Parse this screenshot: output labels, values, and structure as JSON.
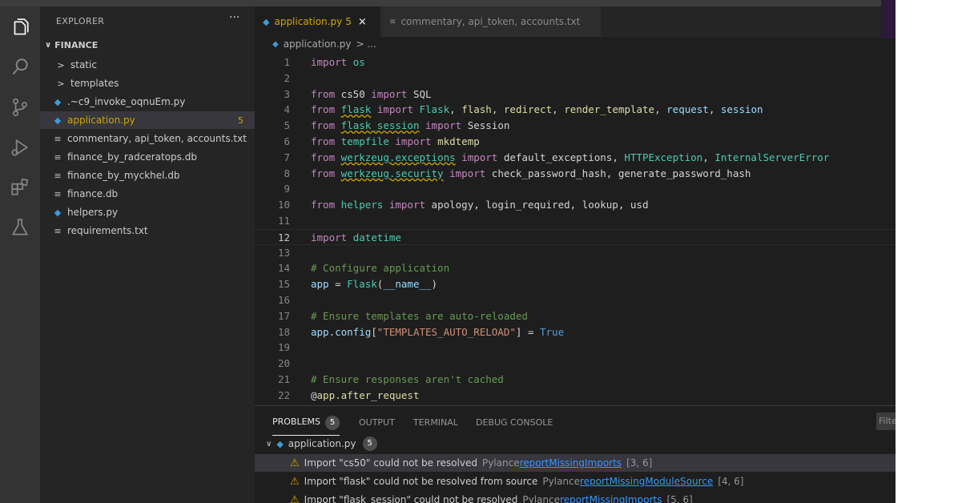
{
  "sidebar": {
    "title": "EXPLORER",
    "more": "···",
    "root": "FINANCE",
    "items": [
      {
        "label": "static",
        "kind": "folder"
      },
      {
        "label": "templates",
        "kind": "folder"
      },
      {
        "label": ".~c9_invoke_oqnuEm.py",
        "kind": "py"
      },
      {
        "label": "application.py",
        "kind": "py",
        "badge": "5"
      },
      {
        "label": "commentary, api_token, accounts.txt",
        "kind": "txt"
      },
      {
        "label": "finance_by_radceratops.db",
        "kind": "db"
      },
      {
        "label": "finance_by_myckhel.db",
        "kind": "db"
      },
      {
        "label": "finance.db",
        "kind": "db"
      },
      {
        "label": "helpers.py",
        "kind": "py"
      },
      {
        "label": "requirements.txt",
        "kind": "txt"
      }
    ]
  },
  "tabs": [
    {
      "label": "application.py",
      "count": "5",
      "close": "×"
    },
    {
      "label": "commentary, api_token, accounts.txt"
    }
  ],
  "breadcrumb": {
    "file": "application.py",
    "sep": "> ..."
  },
  "editor": {
    "current_line": 12,
    "lines": [
      {
        "n": "1",
        "tokens": [
          [
            "kw",
            "import"
          ],
          [
            "plain",
            " "
          ],
          [
            "mod",
            "os"
          ]
        ]
      },
      {
        "n": "2",
        "tokens": []
      },
      {
        "n": "3",
        "tokens": [
          [
            "kw",
            "from"
          ],
          [
            "plain",
            " cs50 "
          ],
          [
            "kw",
            "import"
          ],
          [
            "plain",
            " SQL"
          ]
        ]
      },
      {
        "n": "4",
        "tokens": [
          [
            "kw",
            "from"
          ],
          [
            "plain",
            " "
          ],
          [
            "mod sq",
            "flask"
          ],
          [
            "plain",
            " "
          ],
          [
            "kw",
            "import"
          ],
          [
            "plain",
            " "
          ],
          [
            "mod",
            "Flask"
          ],
          [
            "plain",
            ", "
          ],
          [
            "fn",
            "flash"
          ],
          [
            "plain",
            ", "
          ],
          [
            "fn",
            "redirect"
          ],
          [
            "plain",
            ", "
          ],
          [
            "fn",
            "render_template"
          ],
          [
            "plain",
            ", "
          ],
          [
            "var",
            "request"
          ],
          [
            "plain",
            ", "
          ],
          [
            "var",
            "session"
          ]
        ]
      },
      {
        "n": "5",
        "tokens": [
          [
            "kw",
            "from"
          ],
          [
            "plain",
            " "
          ],
          [
            "mod sq",
            "flask_session"
          ],
          [
            "plain",
            " "
          ],
          [
            "kw",
            "import"
          ],
          [
            "plain",
            " Session"
          ]
        ]
      },
      {
        "n": "6",
        "tokens": [
          [
            "kw",
            "from"
          ],
          [
            "plain",
            " "
          ],
          [
            "mod",
            "tempfile"
          ],
          [
            "plain",
            " "
          ],
          [
            "kw",
            "import"
          ],
          [
            "plain",
            " "
          ],
          [
            "fn",
            "mkdtemp"
          ]
        ]
      },
      {
        "n": "7",
        "tokens": [
          [
            "kw",
            "from"
          ],
          [
            "plain",
            " "
          ],
          [
            "mod sq",
            "werkzeug.exceptions"
          ],
          [
            "plain",
            " "
          ],
          [
            "kw",
            "import"
          ],
          [
            "plain",
            " default_exceptions, "
          ],
          [
            "mod",
            "HTTPException"
          ],
          [
            "plain",
            ", "
          ],
          [
            "mod",
            "InternalServerError"
          ]
        ]
      },
      {
        "n": "8",
        "tokens": [
          [
            "kw",
            "from"
          ],
          [
            "plain",
            " "
          ],
          [
            "mod sq",
            "werkzeug.security"
          ],
          [
            "plain",
            " "
          ],
          [
            "kw",
            "import"
          ],
          [
            "plain",
            " check_password_hash, generate_password_hash"
          ]
        ]
      },
      {
        "n": "9",
        "tokens": []
      },
      {
        "n": "10",
        "tokens": [
          [
            "kw",
            "from"
          ],
          [
            "plain",
            " "
          ],
          [
            "mod",
            "helpers"
          ],
          [
            "plain",
            " "
          ],
          [
            "kw",
            "import"
          ],
          [
            "plain",
            " apology, login_required, lookup, usd"
          ]
        ]
      },
      {
        "n": "11",
        "tokens": []
      },
      {
        "n": "12",
        "tokens": [
          [
            "kw",
            "import"
          ],
          [
            "plain",
            " "
          ],
          [
            "mod",
            "datetime"
          ]
        ]
      },
      {
        "n": "13",
        "tokens": []
      },
      {
        "n": "14",
        "tokens": [
          [
            "cm",
            "# Configure application"
          ]
        ]
      },
      {
        "n": "15",
        "tokens": [
          [
            "var",
            "app"
          ],
          [
            "plain",
            " = "
          ],
          [
            "mod",
            "Flask"
          ],
          [
            "plain",
            "("
          ],
          [
            "var",
            "__name__"
          ],
          [
            "plain",
            ")"
          ]
        ]
      },
      {
        "n": "16",
        "tokens": []
      },
      {
        "n": "17",
        "tokens": [
          [
            "cm",
            "# Ensure templates are auto-reloaded"
          ]
        ]
      },
      {
        "n": "18",
        "tokens": [
          [
            "var",
            "app"
          ],
          [
            "plain",
            "."
          ],
          [
            "var",
            "config"
          ],
          [
            "plain",
            "["
          ],
          [
            "str",
            "\"TEMPLATES_AUTO_RELOAD\""
          ],
          [
            "plain",
            "] = "
          ],
          [
            "const",
            "True"
          ]
        ]
      },
      {
        "n": "19",
        "tokens": []
      },
      {
        "n": "20",
        "tokens": []
      },
      {
        "n": "21",
        "tokens": [
          [
            "cm",
            "# Ensure responses aren't cached"
          ]
        ]
      },
      {
        "n": "22",
        "tokens": [
          [
            "plain",
            "@"
          ],
          [
            "fn",
            "app.after_request"
          ]
        ]
      }
    ]
  },
  "panel": {
    "tabs": [
      {
        "label": "PROBLEMS",
        "badge": "5"
      },
      {
        "label": "OUTPUT"
      },
      {
        "label": "TERMINAL"
      },
      {
        "label": "DEBUG CONSOLE"
      }
    ],
    "filter_placeholder": "Filte",
    "file": {
      "label": "application.py",
      "badge": "5"
    },
    "problems": [
      {
        "msg": "Import \"cs50\" could not be resolved",
        "source": "Pylance",
        "link": "reportMissingImports",
        "pos": "[3, 6]"
      },
      {
        "msg": "Import \"flask\" could not be resolved from source",
        "source": "Pylance",
        "link": "reportMissingModuleSource",
        "pos": "[4, 6]"
      },
      {
        "msg": "Import \"flask_session\" could not be resolved",
        "source": "Pylance",
        "link": "reportMissingImports",
        "pos": "[5, 6]"
      }
    ]
  },
  "colors": {
    "accent_warning": "#cca700",
    "link": "#3794ff",
    "editor_bg": "#1e1e1e"
  }
}
